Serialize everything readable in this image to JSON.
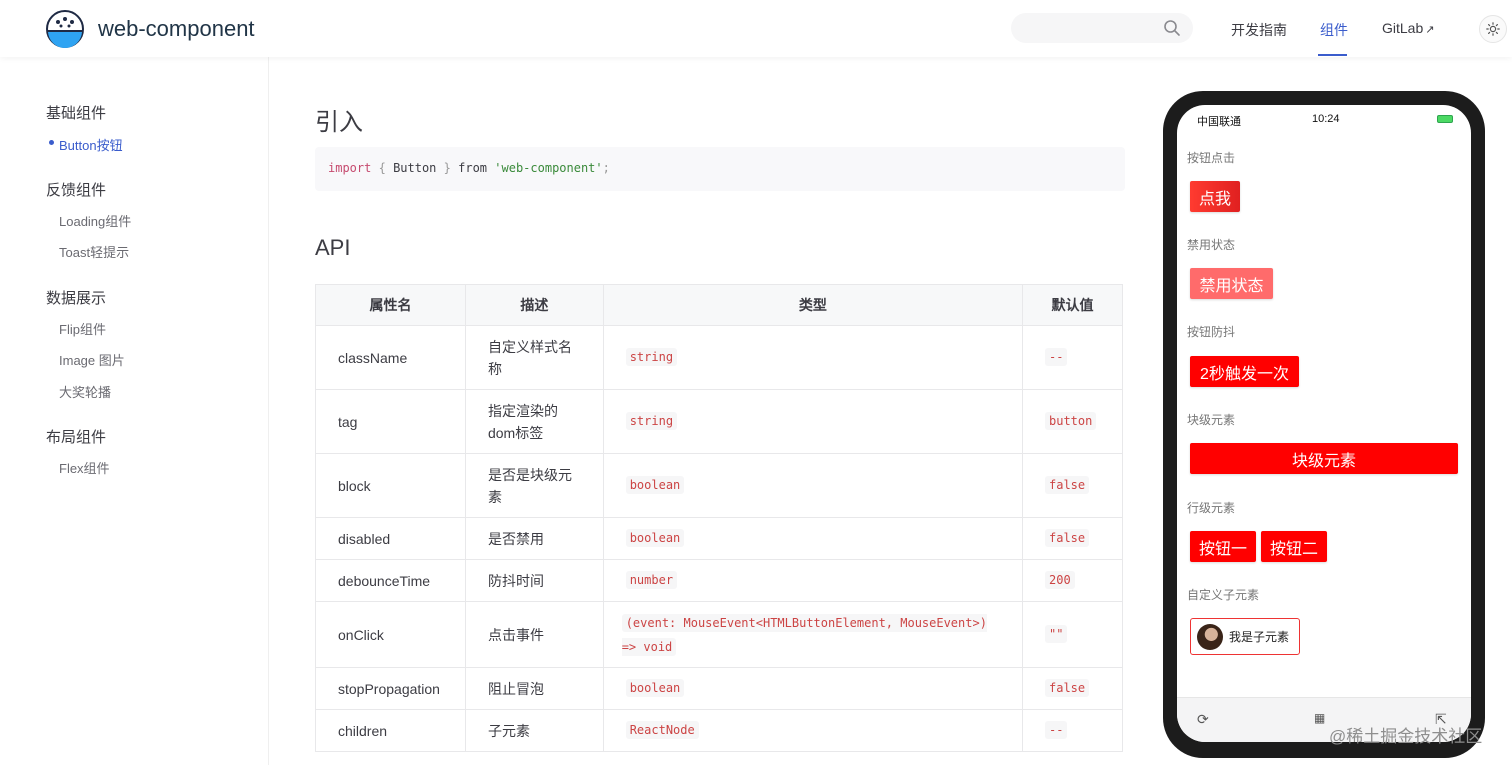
{
  "header": {
    "title": "web-component",
    "nav": [
      {
        "label": "开发指南"
      },
      {
        "label": "组件"
      },
      {
        "label": "GitLab"
      }
    ]
  },
  "sidebar": {
    "groups": [
      {
        "title": "基础组件",
        "items": [
          "Button按钮"
        ]
      },
      {
        "title": "反馈组件",
        "items": [
          "Loading组件",
          "Toast轻提示"
        ]
      },
      {
        "title": "数据展示",
        "items": [
          "Flip组件",
          "Image 图片",
          "大奖轮播"
        ]
      },
      {
        "title": "布局组件",
        "items": [
          "Flex组件"
        ]
      }
    ]
  },
  "main": {
    "import_heading": "引入",
    "code": {
      "kw": "import",
      "open": "{",
      "name": "Button",
      "close": "}",
      "from": "from",
      "module": "'web-component'",
      "semi": ";"
    },
    "api_heading": "API",
    "table": {
      "headers": [
        "属性名",
        "描述",
        "类型",
        "默认值"
      ],
      "rows": [
        {
          "name": "className",
          "desc": "自定义样式名称",
          "type": "string",
          "default": "--"
        },
        {
          "name": "tag",
          "desc": "指定渲染的dom标签",
          "type": "string",
          "default": "button"
        },
        {
          "name": "block",
          "desc": "是否是块级元素",
          "type": "boolean",
          "default": "false"
        },
        {
          "name": "disabled",
          "desc": "是否禁用",
          "type": "boolean",
          "default": "false"
        },
        {
          "name": "debounceTime",
          "desc": "防抖时间",
          "type": "number",
          "default": "200"
        },
        {
          "name": "onClick",
          "desc": "点击事件",
          "type": "(event: MouseEvent<HTMLButtonElement, MouseEvent>) => void",
          "default": "\"\""
        },
        {
          "name": "stopPropagation",
          "desc": "阻止冒泡",
          "type": "boolean",
          "default": "false"
        },
        {
          "name": "children",
          "desc": "子元素",
          "type": "ReactNode",
          "default": "--"
        }
      ]
    }
  },
  "phone": {
    "carrier": "中国联通",
    "time": "10:24",
    "sections": [
      {
        "label": "按钮点击",
        "buttons": [
          "点我"
        ]
      },
      {
        "label": "禁用状态",
        "buttons": [
          "禁用状态"
        ]
      },
      {
        "label": "按钮防抖",
        "buttons": [
          "2秒触发一次"
        ]
      },
      {
        "label": "块级元素",
        "buttons": [
          "块级元素"
        ]
      },
      {
        "label": "行级元素",
        "buttons": [
          "按钮一",
          "按钮二"
        ]
      },
      {
        "label": "自定义子元素",
        "buttons": [
          "我是子元素"
        ]
      }
    ]
  },
  "watermark": "@稀土掘金技术社区"
}
